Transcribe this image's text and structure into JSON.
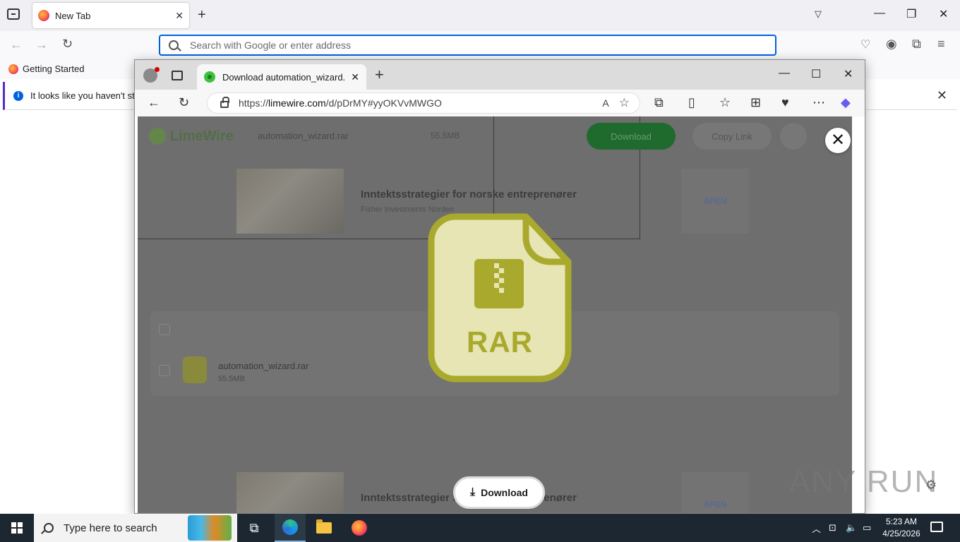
{
  "firefox": {
    "tab_title": "New Tab",
    "url_placeholder": "Search with Google or enter address",
    "bookmark": "Getting Started",
    "notice": "It looks like you haven't start"
  },
  "edge": {
    "tab_title": "Download automation_wizard.rar",
    "url_prefix": "https://",
    "url_domain": "limewire.com",
    "url_path": "/d/pDrMY#yyOKVvMWGO"
  },
  "page": {
    "logo": "LimeWire",
    "file_name": "automation_wizard.rar",
    "file_size": "55.5MB",
    "download_label": "Download",
    "copy_link_label": "Copy Link",
    "ad_headline": "Inntektsstrategier for norske entreprenører",
    "ad_sub": "Fisher Investments Norden",
    "ad_open": "ÅPEN",
    "list_file_name": "automation_wizard.rar",
    "list_file_size": "55.5MB"
  },
  "modal": {
    "file_type": "RAR",
    "download_label": "Download"
  },
  "watermark": "ANY RUN",
  "taskbar": {
    "search_placeholder": "Type here to search",
    "time": "5:23 AM",
    "date": "4/25/2026"
  }
}
